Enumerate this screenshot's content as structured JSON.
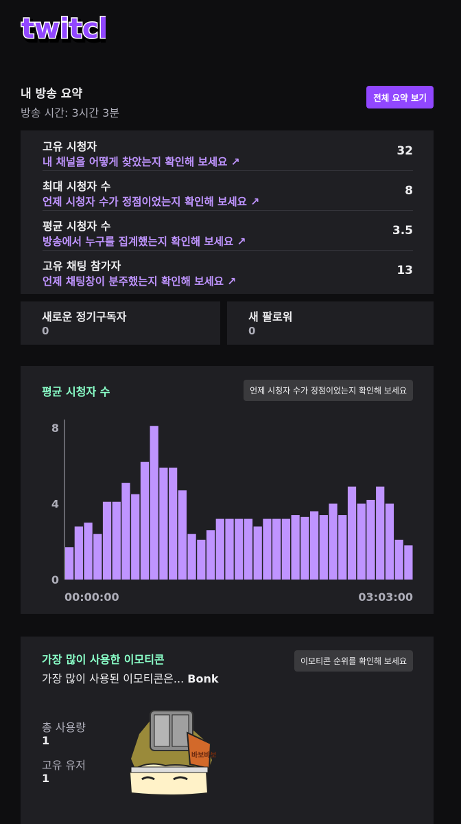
{
  "brand": {
    "logo_text": "twitch",
    "accent": "#9147ff",
    "link_color": "#bf94ff",
    "highlight": "#8affc8"
  },
  "summary": {
    "title": "내 방송 요약",
    "duration": "방송 시간: 3시간 3분",
    "view_all_label": "전체 요약 보기"
  },
  "stats": [
    {
      "label": "고유 시청자",
      "link": "내 채널을 어떻게 찾았는지 확인해 보세요 ↗",
      "value": "32"
    },
    {
      "label": "최대 시청자 수",
      "link": "언제 시청자 수가 정점이었는지 확인해 보세요 ↗",
      "value": "8"
    },
    {
      "label": "평균 시청자 수",
      "link": "방송에서 누구를 집계했는지 확인해 보세요 ↗",
      "value": "3.5"
    },
    {
      "label": "고유 채팅 참가자",
      "link": "언제 채팅창이 분주했는지 확인해 보세요 ↗",
      "value": "13"
    }
  ],
  "new_subscribers": {
    "label": "새로운 정기구독자",
    "value": "0"
  },
  "new_followers": {
    "label": "새 팔로워",
    "value": "0"
  },
  "chart_section": {
    "title": "평균 시청자 수",
    "button_label": "언제 시청자 수가 정점이었는지 확인해 보세요"
  },
  "chart_data": {
    "type": "bar",
    "title": "",
    "xlabel": "",
    "ylabel": "",
    "ylim": [
      0,
      8
    ],
    "y_ticks": [
      "0",
      "4",
      "8"
    ],
    "x_tick_labels": [
      "00:00:00",
      "03:03:00"
    ],
    "bar_color": "#bf94ff",
    "values": [
      1.7,
      2.8,
      3.0,
      2.4,
      4.1,
      4.1,
      5.1,
      4.5,
      6.2,
      8.1,
      5.9,
      5.9,
      4.7,
      2.4,
      2.1,
      2.6,
      3.2,
      3.2,
      3.2,
      3.2,
      2.8,
      3.2,
      3.2,
      3.2,
      3.4,
      3.3,
      3.6,
      3.4,
      4.0,
      3.4,
      4.9,
      4.0,
      4.2,
      4.9,
      4.0,
      2.1,
      1.8
    ]
  },
  "emote_section": {
    "title": "가장 많이 사용한 이모티콘",
    "button_label": "이모티콘 순위를 확인해 보세요",
    "description_prefix": "가장 많이 사용된 이모티콘은... ",
    "emote_name": "Bonk",
    "total_usage_label": "총 사용량",
    "total_usage_value": "1",
    "unique_users_label": "고유 유저",
    "unique_users_value": "1",
    "emote_icon": "bonk-emote",
    "emote_text": "바보바보"
  }
}
